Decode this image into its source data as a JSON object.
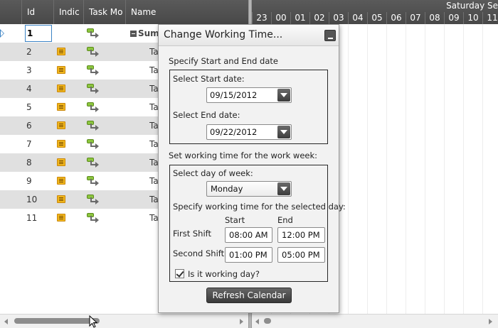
{
  "grid": {
    "columns": {
      "id": "Id",
      "indicators": "Indic",
      "task_mode": "Task Mo",
      "name": "Name"
    },
    "rows": [
      {
        "id": "1",
        "name": "Summ",
        "indicator": "",
        "mode_icon": "auto-scheduled-icon"
      },
      {
        "id": "2",
        "name": "Ta",
        "indicator": "note-icon",
        "mode_icon": "auto-scheduled-icon"
      },
      {
        "id": "3",
        "name": "Ta",
        "indicator": "note-icon",
        "mode_icon": "auto-scheduled-icon"
      },
      {
        "id": "4",
        "name": "Ta",
        "indicator": "note-icon",
        "mode_icon": "auto-scheduled-icon"
      },
      {
        "id": "5",
        "name": "Ta",
        "indicator": "note-icon",
        "mode_icon": "auto-scheduled-icon"
      },
      {
        "id": "6",
        "name": "Ta",
        "indicator": "note-icon",
        "mode_icon": "auto-scheduled-icon"
      },
      {
        "id": "7",
        "name": "Ta",
        "indicator": "note-icon",
        "mode_icon": "auto-scheduled-icon"
      },
      {
        "id": "8",
        "name": "Ta",
        "indicator": "note-icon",
        "mode_icon": "auto-scheduled-icon"
      },
      {
        "id": "9",
        "name": "Ta",
        "indicator": "note-icon",
        "mode_icon": "auto-scheduled-icon"
      },
      {
        "id": "10",
        "name": "Ta",
        "indicator": "note-icon",
        "mode_icon": "auto-scheduled-icon"
      },
      {
        "id": "11",
        "name": "Ta",
        "indicator": "note-icon",
        "mode_icon": "auto-scheduled-icon"
      }
    ]
  },
  "timeline": {
    "day_label": "Saturday Se",
    "hours": [
      "23",
      "00",
      "01",
      "02",
      "03",
      "04",
      "05",
      "06",
      "07",
      "08",
      "09",
      "10",
      "11"
    ]
  },
  "dialog": {
    "title": "Change Working Time...",
    "section_dates": "Specify Start and End date",
    "start_label": "Select Start date:",
    "start_value": "09/15/2012",
    "end_label": "Select End date:",
    "end_value": "09/22/2012",
    "section_week": "Set working time for the work week:",
    "day_label": "Select day of week:",
    "day_value": "Monday",
    "specify_label": "Specify working time for the selected day:",
    "col_start": "Start",
    "col_end": "End",
    "first_shift_label": "First Shift",
    "first_shift_start": "08:00 AM",
    "first_shift_end": "12:00 PM",
    "second_shift_label": "Second Shift",
    "second_shift_start": "01:00 PM",
    "second_shift_end": "05:00 PM",
    "working_day_label": "Is it working day?",
    "working_day_checked": true,
    "refresh_button": "Refresh Calendar"
  },
  "colors": {
    "header_bg": "#4f4f4f",
    "alt_row": "#e0e0e0",
    "selection_border": "#3b83c5",
    "indicator_yellow": "#f1b71d",
    "mode_green": "#8cc63f"
  }
}
